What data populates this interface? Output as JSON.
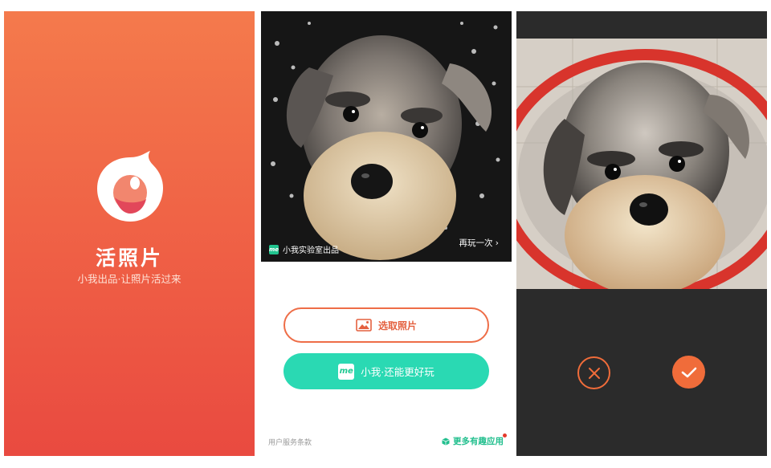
{
  "splash": {
    "app_name": "活照片",
    "tagline": "小我出品·让照片活过来",
    "colors": {
      "top": "#f47a4c",
      "bottom": "#e94a40"
    }
  },
  "home": {
    "photo_badge": "小我实验室出品",
    "badge_icon_text": "me",
    "replay_label": "再玩一次",
    "pick_photo_label": "选取照片",
    "me_icon_text": "me",
    "me_button_label": "小我·还能更好玩",
    "terms_label": "用户服务条款",
    "more_apps_label": "更多有趣应用",
    "colors": {
      "accent": "#ee6d47",
      "teal": "#2ad9b3",
      "green": "#22bf8e"
    }
  },
  "preview": {
    "cancel_icon": "close-icon",
    "confirm_icon": "check-icon",
    "colors": {
      "background": "#2b2b2b",
      "accent": "#f06c3a"
    }
  }
}
